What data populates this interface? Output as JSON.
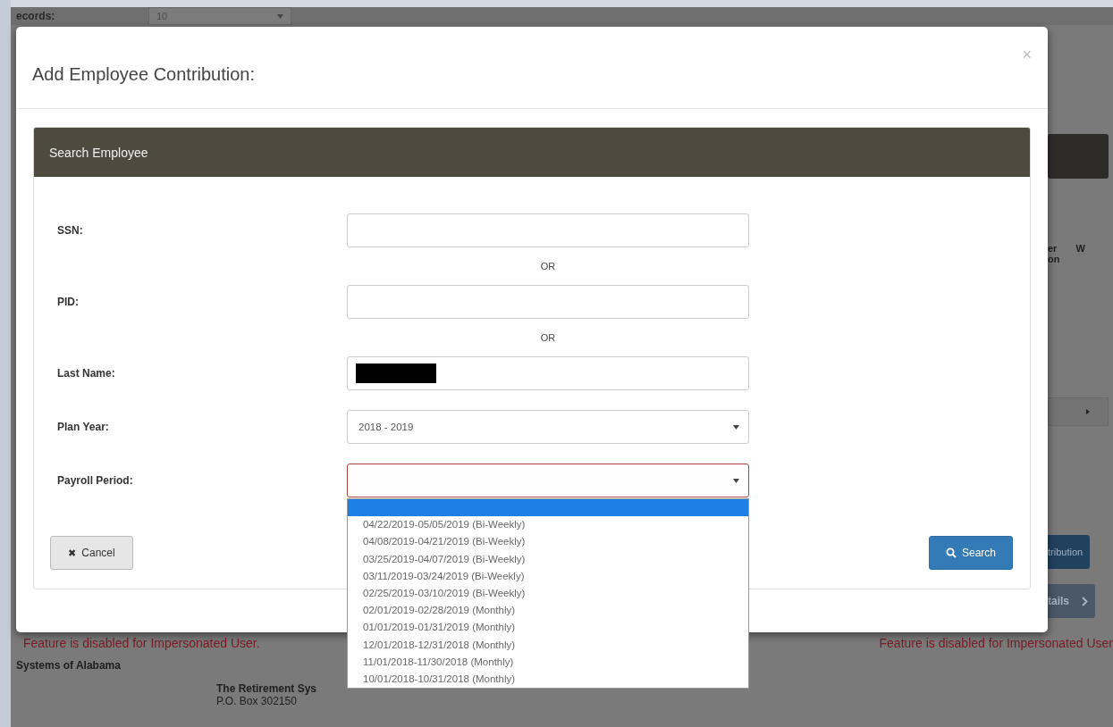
{
  "background": {
    "records_label": "ecords:",
    "records_value": "10",
    "header_fragments": [
      "er",
      "on",
      "W"
    ],
    "buttons": [
      {
        "kind": "primary",
        "label": "tribution"
      },
      {
        "kind": "next",
        "label": "tails"
      }
    ],
    "warnings": [
      "Feature is disabled for Impersonated User.",
      "Feature is disabled for Impersonated User"
    ],
    "footer": {
      "left": "Systems of Alabama",
      "title": "The Retirement Sys",
      "address": "P.O. Box 302150"
    }
  },
  "dialog": {
    "title": "Add Employee Contribution:",
    "close": "×",
    "panel_title": "Search Employee",
    "rows": [
      {
        "kind": "text",
        "label": "SSN:",
        "redacted": false
      },
      {
        "kind": "or",
        "label": "OR"
      },
      {
        "kind": "text",
        "label": "PID:",
        "redacted": false
      },
      {
        "kind": "or",
        "label": "OR"
      },
      {
        "kind": "text",
        "label": "Last Name:",
        "redacted": true
      },
      {
        "kind": "select",
        "label": "Plan Year:",
        "value": "2018 - 2019",
        "invalid": false
      },
      {
        "kind": "select",
        "label": "Payroll Period:",
        "invalid": true,
        "open": true,
        "options": [
          {
            "selected": true
          },
          {
            "label": "04/22/2019-05/05/2019 (Bi-Weekly)",
            "selected": false
          },
          {
            "label": "04/08/2019-04/21/2019 (Bi-Weekly)",
            "selected": false
          },
          {
            "label": "03/25/2019-04/07/2019 (Bi-Weekly)",
            "selected": false
          },
          {
            "label": "03/11/2019-03/24/2019 (Bi-Weekly)",
            "selected": false
          },
          {
            "label": "02/25/2019-03/10/2019 (Bi-Weekly)",
            "selected": false
          },
          {
            "label": "02/01/2019-02/28/2019 (Monthly)",
            "selected": false
          },
          {
            "label": "01/01/2019-01/31/2019 (Monthly)",
            "selected": false
          },
          {
            "label": "12/01/2018-12/31/2018 (Monthly)",
            "selected": false
          },
          {
            "label": "11/01/2018-11/30/2018 (Monthly)",
            "selected": false
          },
          {
            "label": "10/01/2018-10/31/2018 (Monthly)",
            "selected": false
          }
        ]
      }
    ],
    "cancel": {
      "icon": "✖",
      "label": "Cancel"
    },
    "search": {
      "label": "Search"
    }
  }
}
